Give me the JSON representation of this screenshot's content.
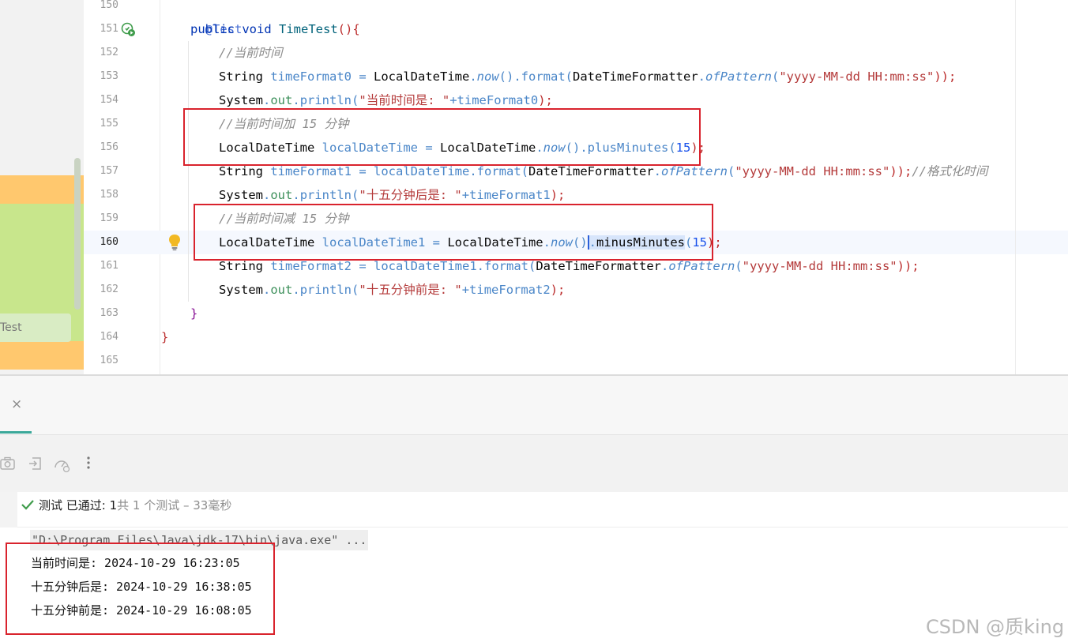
{
  "editor": {
    "line_numbers": [
      "150",
      "151",
      "152",
      "153",
      "154",
      "155",
      "156",
      "157",
      "158",
      "159",
      "160",
      "161",
      "162",
      "163",
      "164",
      "165"
    ],
    "current_line": "160",
    "lines": {
      "l150": {
        "ann": "@Test"
      },
      "l151": {
        "kw_public": "public",
        "kw_void": "void",
        "method": "TimeTest",
        "open": "(){"
      },
      "l152": {
        "comment": "//当前时间"
      },
      "l153": {
        "type": "String",
        "var": "timeFormat0",
        "eq": " = ",
        "cls": "LocalDateTime",
        "dot1": ".",
        "m1": "now",
        "p1": "().",
        "m2": "format",
        "p2": "(",
        "cls2": "DateTimeFormatter",
        "dot2": ".",
        "m3": "ofPattern",
        "p3": "(",
        "str": "\"yyyy-MM-dd HH:mm:ss\"",
        "end": "));"
      },
      "l154": {
        "cls": "System",
        "dot": ".",
        "field": "out",
        "dot2": ".",
        "m": "println",
        "p": "(",
        "str": "\"当前时间是: \"",
        "plus": "+",
        "var": "timeFormat0",
        "end": ");"
      },
      "l155": {
        "comment": "//当前时间加 15 分钟"
      },
      "l156": {
        "type": "LocalDateTime",
        "var": "localDateTime",
        "eq": " = ",
        "cls": "LocalDateTime",
        "dot": ".",
        "m1": "now",
        "p1": "().",
        "m2": "plusMinutes",
        "p2": "(",
        "num": "15",
        "end": ");"
      },
      "l157": {
        "type": "String",
        "var": "timeFormat1",
        "eq": " = ",
        "obj": "localDateTime",
        "dot": ".",
        "m1": "format",
        "p1": "(",
        "cls2": "DateTimeFormatter",
        "dot2": ".",
        "m2": "ofPattern",
        "p2": "(",
        "str": "\"yyyy-MM-dd HH:mm:ss\"",
        "end": "));",
        "comment": "//格式化时间"
      },
      "l158": {
        "cls": "System",
        "dot": ".",
        "field": "out",
        "dot2": ".",
        "m": "println",
        "p": "(",
        "str": "\"十五分钟后是: \"",
        "plus": "+",
        "var": "timeFormat1",
        "end": ");"
      },
      "l159": {
        "comment": "//当前时间减 15 分钟"
      },
      "l160": {
        "type": "LocalDateTime",
        "var": "localDateTime1",
        "eq": " = ",
        "cls": "LocalDateTime",
        "dot": ".",
        "m1": "now",
        "p1": "()",
        "p1b": ".",
        "m2": "minusMinutes",
        "p2": "(",
        "num": "15",
        "end": ");"
      },
      "l161": {
        "type": "String",
        "var": "timeFormat2",
        "eq": " = ",
        "obj": "localDateTime1",
        "dot": ".",
        "m1": "format",
        "p1": "(",
        "cls2": "DateTimeFormatter",
        "dot2": ".",
        "m2": "ofPattern",
        "p2": "(",
        "str": "\"yyyy-MM-dd HH:mm:ss\"",
        "end": "));"
      },
      "l162": {
        "cls": "System",
        "dot": ".",
        "field": "out",
        "dot2": ".",
        "m": "println",
        "p": "(",
        "str": "\"十五分钟前是: \"",
        "plus": "+",
        "var": "timeFormat2",
        "end": ");"
      },
      "l163": {
        "brace": "}"
      },
      "l164": {
        "brace": "}"
      }
    }
  },
  "project_panel": {
    "node_label": "Test"
  },
  "run_panel": {
    "close_glyph": "×",
    "toolbar_icons": [
      "camera-icon",
      "export-icon",
      "speedometer-icon",
      "more-icon"
    ],
    "status": {
      "prefix": "测试 已通过: ",
      "passed": "1",
      "suffix": "共 1 个测试 – 33毫秒"
    },
    "console": {
      "command": "\"D:\\Program Files\\Java\\jdk-17\\bin\\java.exe\" ...",
      "output": [
        "当前时间是: 2024-10-29 16:23:05",
        "十五分钟后是: 2024-10-29 16:38:05",
        "十五分钟前是: 2024-10-29 16:08:05"
      ]
    }
  },
  "watermark": "CSDN @质king",
  "colors": {
    "highlight_box": "#d9232d",
    "pass_check": "#3f9c4b"
  }
}
